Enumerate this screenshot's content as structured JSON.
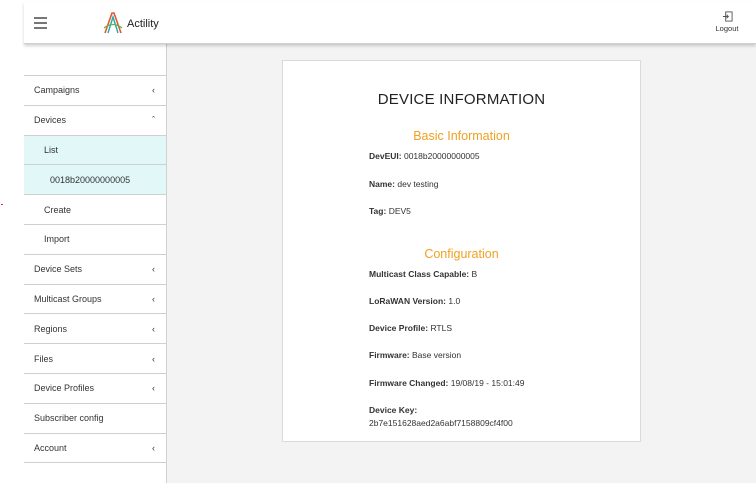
{
  "header": {
    "logo_text": "Actility",
    "logout_label": "Logout"
  },
  "sidebar": {
    "items": [
      {
        "label": "Campaigns",
        "chevron": "‹"
      },
      {
        "label": "Devices",
        "chevron": "ˆ"
      },
      {
        "label": "List",
        "chevron": ""
      },
      {
        "label": "0018b20000000005",
        "chevron": ""
      },
      {
        "label": "Create",
        "chevron": ""
      },
      {
        "label": "Import",
        "chevron": ""
      },
      {
        "label": "Device Sets",
        "chevron": "‹"
      },
      {
        "label": "Multicast Groups",
        "chevron": "‹"
      },
      {
        "label": "Regions",
        "chevron": "‹"
      },
      {
        "label": "Files",
        "chevron": "‹"
      },
      {
        "label": "Device Profiles",
        "chevron": "‹"
      },
      {
        "label": "Subscriber config",
        "chevron": ""
      },
      {
        "label": "Account",
        "chevron": "‹"
      }
    ]
  },
  "card": {
    "title": "DEVICE INFORMATION",
    "basic": {
      "title": "Basic Information",
      "deveui_label": "DevEUI:",
      "deveui_value": "0018b20000000005",
      "name_label": "Name:",
      "name_value": "dev testing",
      "tag_label": "Tag:",
      "tag_value": "DEV5"
    },
    "config": {
      "title": "Configuration",
      "multicast_label": "Multicast Class Capable:",
      "multicast_value": "B",
      "lorawan_label": "LoRaWAN Version:",
      "lorawan_value": "1.0",
      "profile_label": "Device Profile:",
      "profile_value": "RTLS",
      "firmware_label": "Firmware:",
      "firmware_value": "Base version",
      "fw_changed_label": "Firmware Changed:",
      "fw_changed_value": "19/08/19 - 15:01:49",
      "key_label": "Device Key:",
      "key_value": "2b7e151628aed2a6abf7158809cf4f00"
    }
  },
  "colors": {
    "accent_orange": "#f0a020",
    "active_item_bg": "#e1f7f8"
  }
}
